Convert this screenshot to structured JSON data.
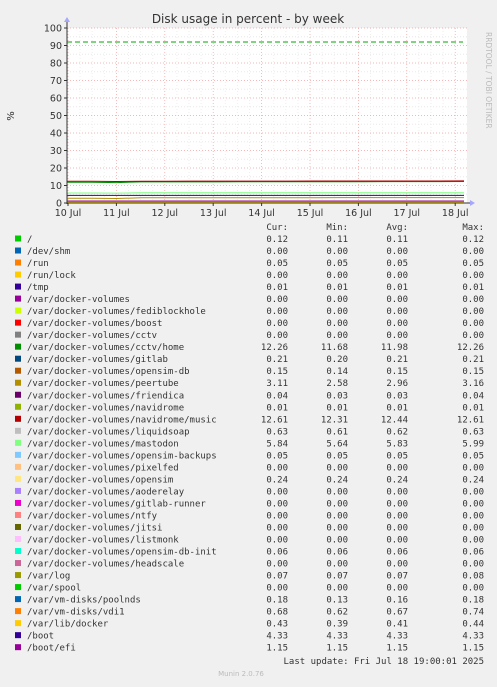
{
  "chart_data": {
    "type": "line",
    "title": "Disk usage in percent - by week",
    "ylabel": "%",
    "watermark": "RRDTOOL / TOBI OETIKER",
    "ylim": [
      0,
      100
    ],
    "yticks": [
      0,
      10,
      20,
      30,
      40,
      50,
      60,
      70,
      80,
      90,
      100
    ],
    "xlim": [
      "10 Jul",
      "18 Jul 12:00"
    ],
    "xticks": [
      "10 Jul",
      "11 Jul",
      "12 Jul",
      "13 Jul",
      "14 Jul",
      "15 Jul",
      "16 Jul",
      "17 Jul",
      "18 Jul"
    ],
    "warning_level": 92,
    "grid": true,
    "legend_headers": [
      "Cur:",
      "Min:",
      "Avg:",
      "Max:"
    ],
    "series": [
      {
        "name": "/",
        "color": "#00cc00",
        "cur": "0.12",
        "min": "0.11",
        "avg": "0.11",
        "max": "0.12"
      },
      {
        "name": "/dev/shm",
        "color": "#0066b3",
        "cur": "0.00",
        "min": "0.00",
        "avg": "0.00",
        "max": "0.00"
      },
      {
        "name": "/run",
        "color": "#ff8000",
        "cur": "0.05",
        "min": "0.05",
        "avg": "0.05",
        "max": "0.05"
      },
      {
        "name": "/run/lock",
        "color": "#ffcc00",
        "cur": "0.00",
        "min": "0.00",
        "avg": "0.00",
        "max": "0.00"
      },
      {
        "name": "/tmp",
        "color": "#330099",
        "cur": "0.01",
        "min": "0.01",
        "avg": "0.01",
        "max": "0.01"
      },
      {
        "name": "/var/docker-volumes",
        "color": "#990099",
        "cur": "0.00",
        "min": "0.00",
        "avg": "0.00",
        "max": "0.00"
      },
      {
        "name": "/var/docker-volumes/fediblockhole",
        "color": "#ccff00",
        "cur": "0.00",
        "min": "0.00",
        "avg": "0.00",
        "max": "0.00"
      },
      {
        "name": "/var/docker-volumes/boost",
        "color": "#ff0000",
        "cur": "0.00",
        "min": "0.00",
        "avg": "0.00",
        "max": "0.00"
      },
      {
        "name": "/var/docker-volumes/cctv",
        "color": "#808080",
        "cur": "0.00",
        "min": "0.00",
        "avg": "0.00",
        "max": "0.00"
      },
      {
        "name": "/var/docker-volumes/cctv/home",
        "color": "#008f00",
        "cur": "12.26",
        "min": "11.68",
        "avg": "11.98",
        "max": "12.26"
      },
      {
        "name": "/var/docker-volumes/gitlab",
        "color": "#00487d",
        "cur": "0.21",
        "min": "0.20",
        "avg": "0.21",
        "max": "0.21"
      },
      {
        "name": "/var/docker-volumes/opensim-db",
        "color": "#b35a00",
        "cur": "0.15",
        "min": "0.14",
        "avg": "0.15",
        "max": "0.15"
      },
      {
        "name": "/var/docker-volumes/peertube",
        "color": "#b38f00",
        "cur": "3.11",
        "min": "2.58",
        "avg": "2.96",
        "max": "3.16"
      },
      {
        "name": "/var/docker-volumes/friendica",
        "color": "#6b006b",
        "cur": "0.04",
        "min": "0.03",
        "avg": "0.03",
        "max": "0.04"
      },
      {
        "name": "/var/docker-volumes/navidrome",
        "color": "#8fb300",
        "cur": "0.01",
        "min": "0.01",
        "avg": "0.01",
        "max": "0.01"
      },
      {
        "name": "/var/docker-volumes/navidrome/music",
        "color": "#b30000",
        "cur": "12.61",
        "min": "12.31",
        "avg": "12.44",
        "max": "12.61"
      },
      {
        "name": "/var/docker-volumes/liquidsoap",
        "color": "#bebebe",
        "cur": "0.63",
        "min": "0.61",
        "avg": "0.62",
        "max": "0.63"
      },
      {
        "name": "/var/docker-volumes/mastodon",
        "color": "#80ff80",
        "cur": "5.84",
        "min": "5.64",
        "avg": "5.83",
        "max": "5.99"
      },
      {
        "name": "/var/docker-volumes/opensim-backups",
        "color": "#80c9ff",
        "cur": "0.05",
        "min": "0.05",
        "avg": "0.05",
        "max": "0.05"
      },
      {
        "name": "/var/docker-volumes/pixelfed",
        "color": "#ffc080",
        "cur": "0.00",
        "min": "0.00",
        "avg": "0.00",
        "max": "0.00"
      },
      {
        "name": "/var/docker-volumes/opensim",
        "color": "#ffe680",
        "cur": "0.24",
        "min": "0.24",
        "avg": "0.24",
        "max": "0.24"
      },
      {
        "name": "/var/docker-volumes/aoderelay",
        "color": "#aa80ff",
        "cur": "0.00",
        "min": "0.00",
        "avg": "0.00",
        "max": "0.00"
      },
      {
        "name": "/var/docker-volumes/gitlab-runner",
        "color": "#ee00cc",
        "cur": "0.00",
        "min": "0.00",
        "avg": "0.00",
        "max": "0.00"
      },
      {
        "name": "/var/docker-volumes/ntfy",
        "color": "#ff8080",
        "cur": "0.00",
        "min": "0.00",
        "avg": "0.00",
        "max": "0.00"
      },
      {
        "name": "/var/docker-volumes/jitsi",
        "color": "#666600",
        "cur": "0.00",
        "min": "0.00",
        "avg": "0.00",
        "max": "0.00"
      },
      {
        "name": "/var/docker-volumes/listmonk",
        "color": "#ffbfff",
        "cur": "0.00",
        "min": "0.00",
        "avg": "0.00",
        "max": "0.00"
      },
      {
        "name": "/var/docker-volumes/opensim-db-init",
        "color": "#00ffcc",
        "cur": "0.06",
        "min": "0.06",
        "avg": "0.06",
        "max": "0.06"
      },
      {
        "name": "/var/docker-volumes/headscale",
        "color": "#cc6699",
        "cur": "0.00",
        "min": "0.00",
        "avg": "0.00",
        "max": "0.00"
      },
      {
        "name": "/var/log",
        "color": "#999900",
        "cur": "0.07",
        "min": "0.07",
        "avg": "0.07",
        "max": "0.08"
      },
      {
        "name": "/var/spool",
        "color": "#00cc00",
        "cur": "0.00",
        "min": "0.00",
        "avg": "0.00",
        "max": "0.00"
      },
      {
        "name": "/var/vm-disks/poolnds",
        "color": "#0066b3",
        "cur": "0.18",
        "min": "0.13",
        "avg": "0.16",
        "max": "0.18"
      },
      {
        "name": "/var/vm-disks/vdi1",
        "color": "#ff8000",
        "cur": "0.68",
        "min": "0.62",
        "avg": "0.67",
        "max": "0.74"
      },
      {
        "name": "/var/lib/docker",
        "color": "#ffcc00",
        "cur": "0.43",
        "min": "0.39",
        "avg": "0.41",
        "max": "0.44"
      },
      {
        "name": "/boot",
        "color": "#330099",
        "cur": "4.33",
        "min": "4.33",
        "avg": "4.33",
        "max": "4.33"
      },
      {
        "name": "/boot/efi",
        "color": "#990099",
        "cur": "1.15",
        "min": "1.15",
        "avg": "1.15",
        "max": "1.15"
      }
    ],
    "last_update": "Last update:  Fri Jul 18 19:00:01 2025",
    "footer": "Munin 2.0.76"
  }
}
